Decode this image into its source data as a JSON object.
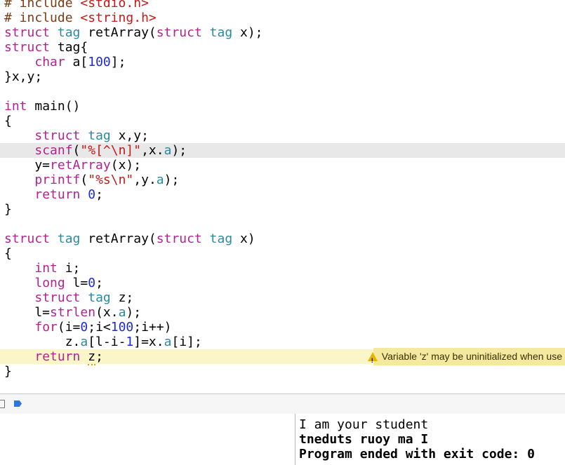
{
  "editor": {
    "lines": {
      "l1": "# include <stdio.h>",
      "l2": "# include <string.h>",
      "l3": "struct tag retArray(struct tag x);",
      "l4": "struct tag{",
      "l5": "    char a[100];",
      "l6": "}x,y;",
      "l7": "",
      "l8": "int main()",
      "l9": "{",
      "l10": "    struct tag x,y;",
      "l11": "    scanf(\"%[^\\n]\",x.a);",
      "l12": "    y=retArray(x);",
      "l13": "    printf(\"%s\\n\",y.a);",
      "l14": "    return 0;",
      "l15": "}",
      "l16": "",
      "l17": "struct tag retArray(struct tag x)",
      "l18": "{",
      "l19": "    int i;",
      "l20": "    long l=0;",
      "l21": "    struct tag z;",
      "l22": "    l=strlen(x.a);",
      "l23": "    for(i=0;i<100;i++)",
      "l24": "        z.a[l-i-1]=x.a[i];",
      "l25": "    return z;",
      "l26": "}"
    },
    "warning": "Variable 'z' may be uninitialized when use",
    "warning_icon": "warning-triangle-icon"
  },
  "console": {
    "line1": "I am your student",
    "line2": "tneduts ruoy ma I",
    "line3": "Program ended with exit code: 0"
  },
  "colors": {
    "keyword": "#b3238f",
    "number": "#1d2bd6",
    "string": "#c41a16",
    "type_ref": "#2a8a9e",
    "current_line": "#e8e8e8",
    "warning_line": "#fbf6c8",
    "breakpoint": "#2d74e8"
  }
}
